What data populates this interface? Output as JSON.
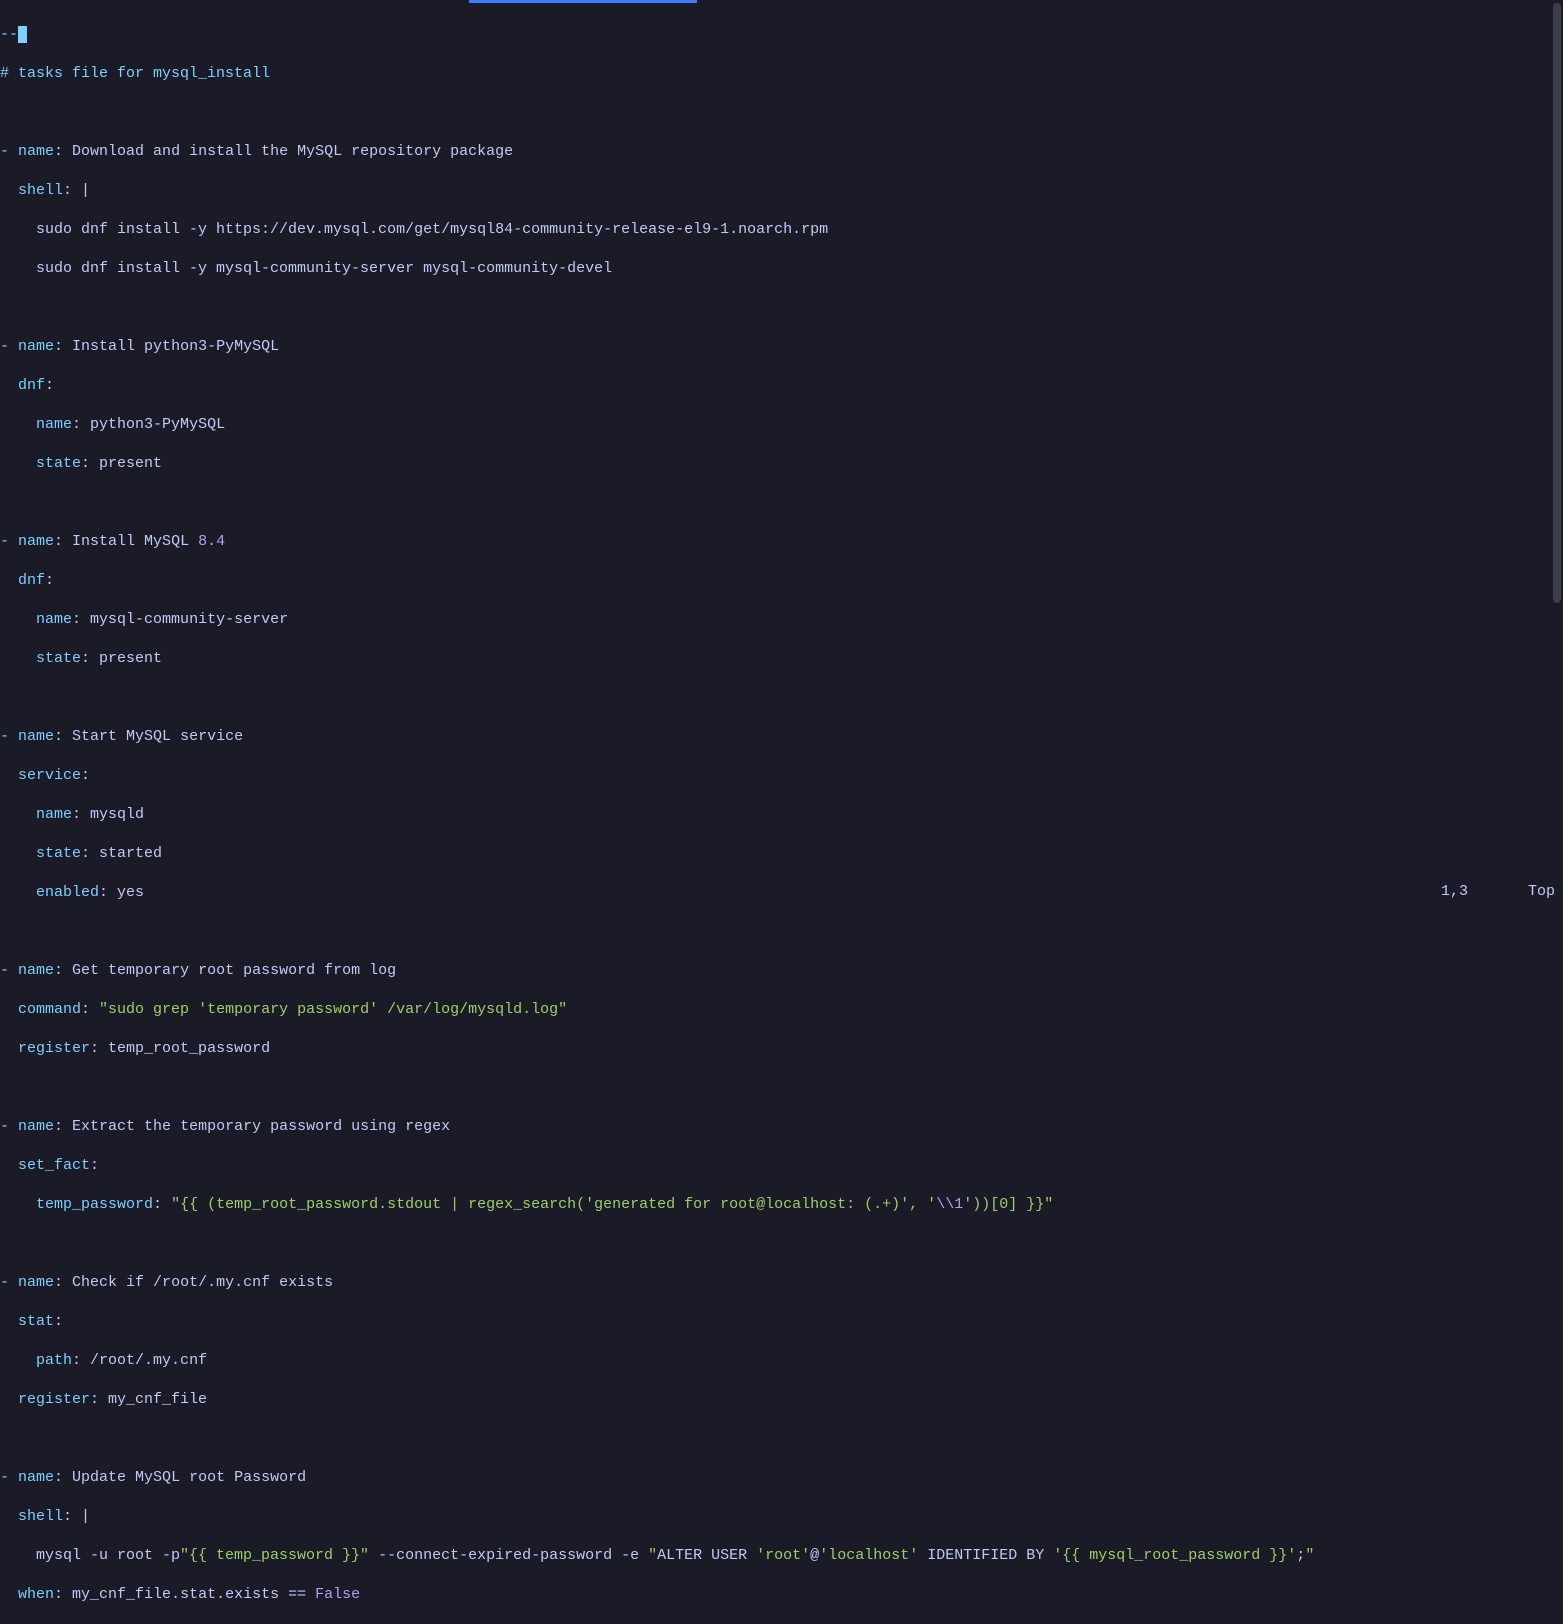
{
  "top": {
    "dashes": "--",
    "cursor": "-",
    "comment": "# tasks file for mysql_install"
  },
  "tasks": [
    {
      "name_key": "name",
      "name_val": "Download and install the MySQL repository package",
      "module": "shell",
      "pipe": "|",
      "body": [
        "    sudo dnf install -y https://dev.mysql.com/get/mysql84-community-release-el9-1.noarch.rpm",
        "    sudo dnf install -y mysql-community-server mysql-community-devel"
      ]
    },
    {
      "name_key": "name",
      "name_val": "Install python3-PyMySQL",
      "module": "dnf",
      "params": [
        {
          "key": "name",
          "val": "python3-PyMySQL"
        },
        {
          "key": "state",
          "val": "present"
        }
      ]
    },
    {
      "name_key": "name",
      "name_val": "Install MySQL ",
      "name_num": "8.4",
      "module": "dnf",
      "params": [
        {
          "key": "name",
          "val": "mysql-community-server"
        },
        {
          "key": "state",
          "val": "present"
        }
      ]
    },
    {
      "name_key": "name",
      "name_val": "Start MySQL service",
      "module": "service",
      "params": [
        {
          "key": "name",
          "val": "mysqld"
        },
        {
          "key": "state",
          "val": "started"
        },
        {
          "key": "enabled",
          "val": "yes"
        }
      ]
    },
    {
      "name_key": "name",
      "name_val": "Get temporary root password from log",
      "module": "command",
      "command_val": "\"sudo grep 'temporary password' /var/log/mysqld.log\"",
      "register_key": "register",
      "register_val": "temp_root_password"
    },
    {
      "name_key": "name",
      "name_val": "Extract the temporary password using regex",
      "module": "set_fact",
      "fact_key": "temp_password",
      "fact_prefix": "\"{{ (temp_root_password.stdout | regex_search('generated for root@localhost: (.+)', '",
      "fact_escape": "\\\\1",
      "fact_suffix": "'))[0] }}\""
    },
    {
      "name_key": "name",
      "name_val": "Check if /root/.my.cnf exists",
      "module": "stat",
      "params": [
        {
          "key": "path",
          "val": "/root/.my.cnf"
        }
      ],
      "register_key": "register",
      "register_val": "my_cnf_file"
    },
    {
      "name_key": "name",
      "name_val": "Update MySQL root Password",
      "module": "shell",
      "pipe": "|",
      "shell_line": {
        "p1": "    mysql -u root -p",
        "s1": "\"{{ temp_password }}\"",
        "p2": " --connect-expired-password -e ",
        "q1": "\"",
        "p3": "ALTER USER ",
        "s2": "'root'",
        "at": "@",
        "s3": "'localhost'",
        "p4": " IDENTIFIED BY ",
        "s4": "'{{ mysql_root_password }}'",
        "semi": ";",
        "q2": "\""
      },
      "when_key": "when",
      "when_val": "my_cnf_file.stat.exists == ",
      "when_bool": "False"
    }
  ],
  "status": {
    "pos": "1,3",
    "scroll": "Top"
  }
}
